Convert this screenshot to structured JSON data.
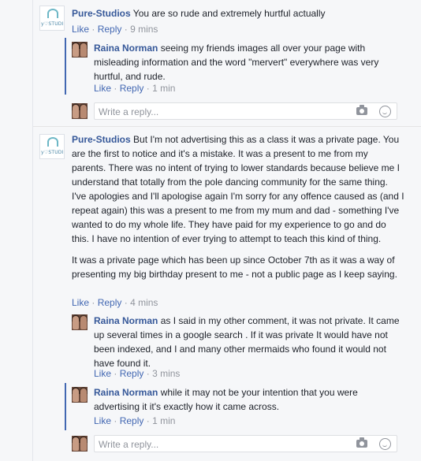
{
  "thread": {
    "comments": [
      {
        "author": "Pure-Studios",
        "text": "You are so rude and extremely hurtful actually",
        "like": "Like",
        "reply": "Reply",
        "time": "9 mins",
        "avatar_text": "y♡STUDIOS"
      },
      {
        "author": "Pure-Studios",
        "text": "But I'm not advertising this as a class it was a private page. You are the first to notice and it's a mistake. It was a present to me from my parents. There was no intent of trying to lower standards because believe me I understand that totally from the pole dancing community for the same thing. I've apologies and I'll apologise again I'm sorry for any offence caused as (and I repeat again) this was a present to me from my mum and dad - something I've wanted to do my whole life. They have paid for my experience to go and do this. I have no intention of ever trying to attempt to teach this kind of thing.",
        "text2": "It was a private page which has been up since October 7th as it was a way of presenting my big birthday present to me - not a public page as I keep saying.",
        "like": "Like",
        "reply": "Reply",
        "time": "4 mins",
        "avatar_text": "y♡STUDIOS"
      }
    ],
    "replies": [
      {
        "author": "Raina Norman",
        "text": "seeing my friends images all over your page with misleading information and the word \"mervert\" everywhere was very hurtful, and rude.",
        "like": "Like",
        "reply": "Reply",
        "time": "1 min"
      },
      {
        "author": "Raina Norman",
        "text": "as I said in my other comment, it was not private. It came up several times in a google search . If it was private It would have not been indexed, and I and many other mermaids who found it would not have found it.",
        "like": "Like",
        "reply": "Reply",
        "time": "3 mins"
      },
      {
        "author": "Raina Norman",
        "text": "while it may not be your intention that you were advertising it it's exactly how it came across.",
        "like": "Like",
        "reply": "Reply",
        "time": "1 min"
      }
    ],
    "reply_box": {
      "placeholder": "Write a reply..."
    },
    "separator": "·"
  }
}
